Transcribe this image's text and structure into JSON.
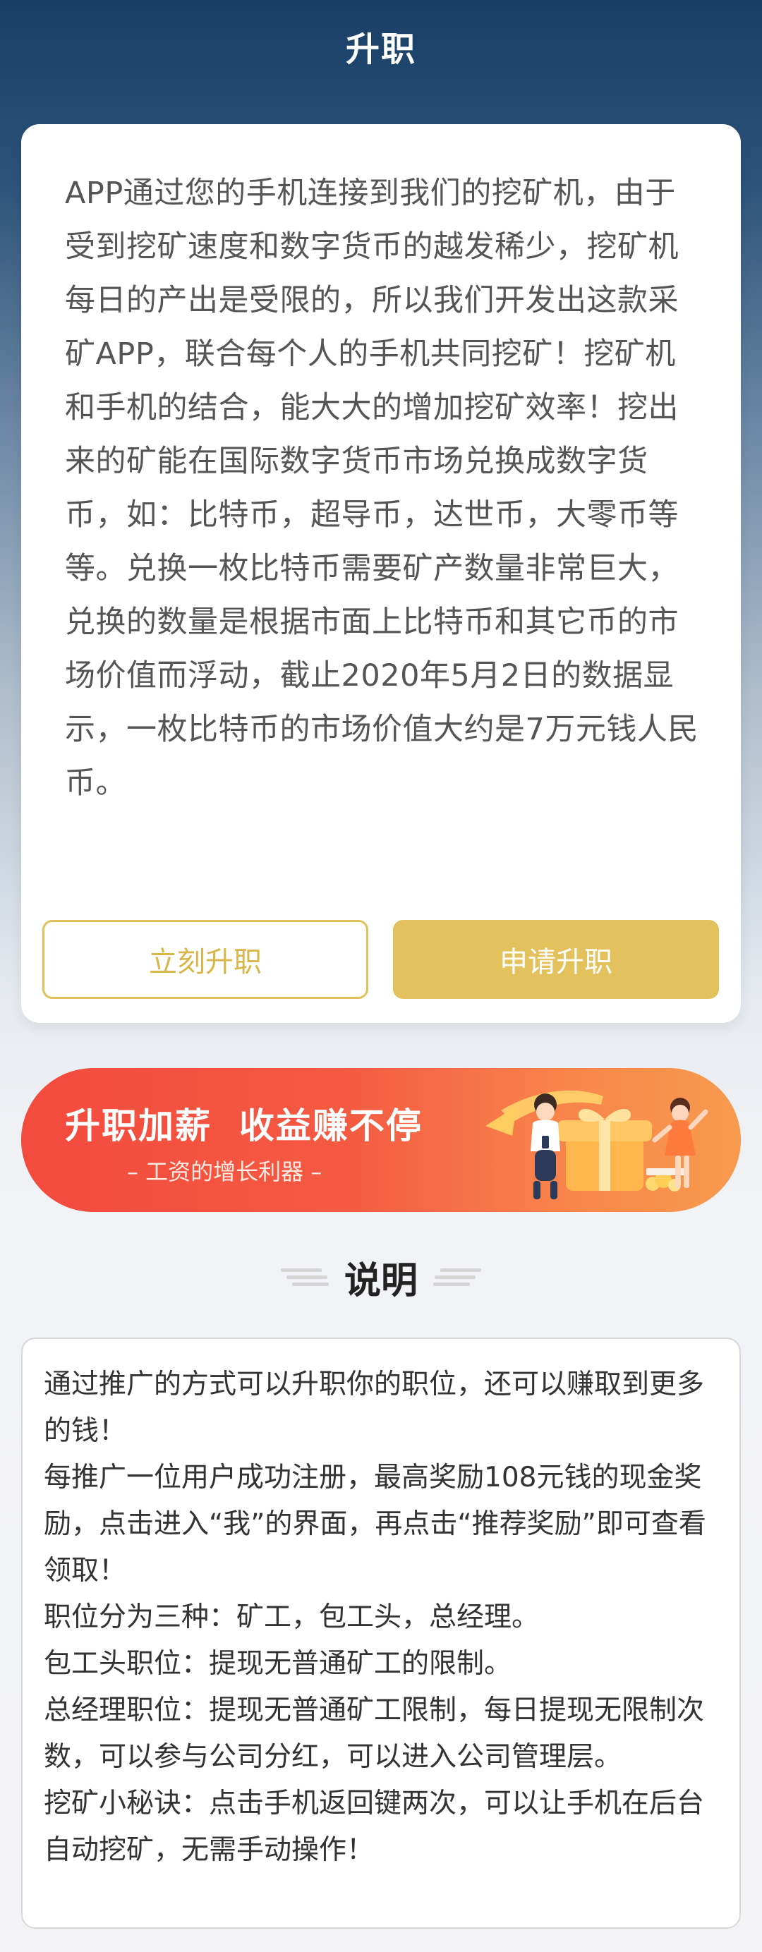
{
  "header": {
    "title": "升职"
  },
  "card": {
    "description": "APP通过您的手机连接到我们的挖矿机，由于受到挖矿速度和数字货币的越发稀少，挖矿机每日的产出是受限的，所以我们开发出这款采矿APP，联合每个人的手机共同挖矿！挖矿机和手机的结合，能大大的增加挖矿效率！挖出来的矿能在国际数字货币市场兑换成数字货币，如：比特币，超导币，达世币，大零币等等。兑换一枚比特币需要矿产数量非常巨大，兑换的数量是根据市面上比特币和其它币的市场价值而浮动，截止2020年5月2日的数据显示，一枚比特币的市场价值大约是7万元钱人民币。",
    "button_primary_outline": "立刻升职",
    "button_primary_fill": "申请升职"
  },
  "banner": {
    "title": "升职加薪  收益赚不停",
    "subtitle": "– 工资的增长利器 –"
  },
  "section": {
    "title": "说明"
  },
  "info": {
    "lines": [
      "通过推广的方式可以升职你的职位，还可以赚取到更多的钱！",
      "每推广一位用户成功注册，最高奖励108元钱的现金奖励，点击进入“我”的界面，再点击“推荐奖励”即可查看领取！",
      "职位分为三种：矿工，包工头，总经理。",
      "包工头职位：提现无普通矿工的限制。",
      "总经理职位：提现无普通矿工限制，每日提现无限制次数，可以参与公司分红，可以进入公司管理层。",
      "挖矿小秘诀：点击手机返回键两次，可以让手机在后台自动挖矿，无需手动操作！"
    ]
  },
  "colors": {
    "accent_gold": "#e3c25d",
    "banner_red": "#f34a3e",
    "banner_orange": "#f79b4e",
    "header_blue": "#183e66"
  }
}
